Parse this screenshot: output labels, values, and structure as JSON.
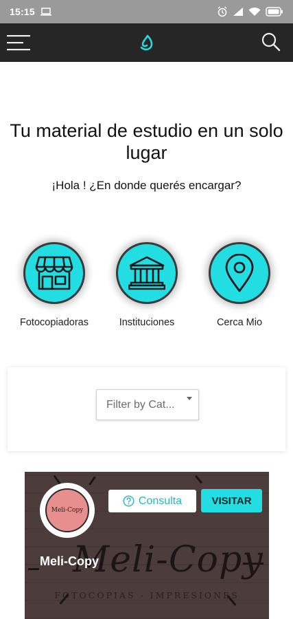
{
  "status_bar": {
    "time": "15:15",
    "icons": [
      "laptop-icon",
      "alarm-icon",
      "signal-icon",
      "wifi-icon",
      "battery-icon"
    ]
  },
  "app_bar": {
    "icons": [
      "menu-icon",
      "app-logo-icon",
      "search-icon"
    ]
  },
  "hero": {
    "title": "Tu material de estudio en un solo lugar",
    "greeting": "¡Hola ! ¿En donde querés encargar?"
  },
  "categories": [
    {
      "label": "Fotocopiadoras",
      "icon": "storefront-icon"
    },
    {
      "label": "Instituciones",
      "icon": "institution-icon"
    },
    {
      "label": "Cerca Mio",
      "icon": "location-pin-icon"
    }
  ],
  "filter": {
    "placeholder": "Filter by Cat..."
  },
  "shop": {
    "name": "Meli-Copy",
    "avatar_text": "Meli-Copy",
    "banner_name": "Meli-Copy",
    "banner_tagline": "FOTOCOPIAS - IMPRESIONES",
    "consulta_label": "Consulta",
    "visitar_label": "VISITAR"
  },
  "colors": {
    "accent": "#22dde2",
    "app_bar": "#262626",
    "status_bar": "#9a9a9a",
    "shop_banner": "#4c3c3b"
  }
}
